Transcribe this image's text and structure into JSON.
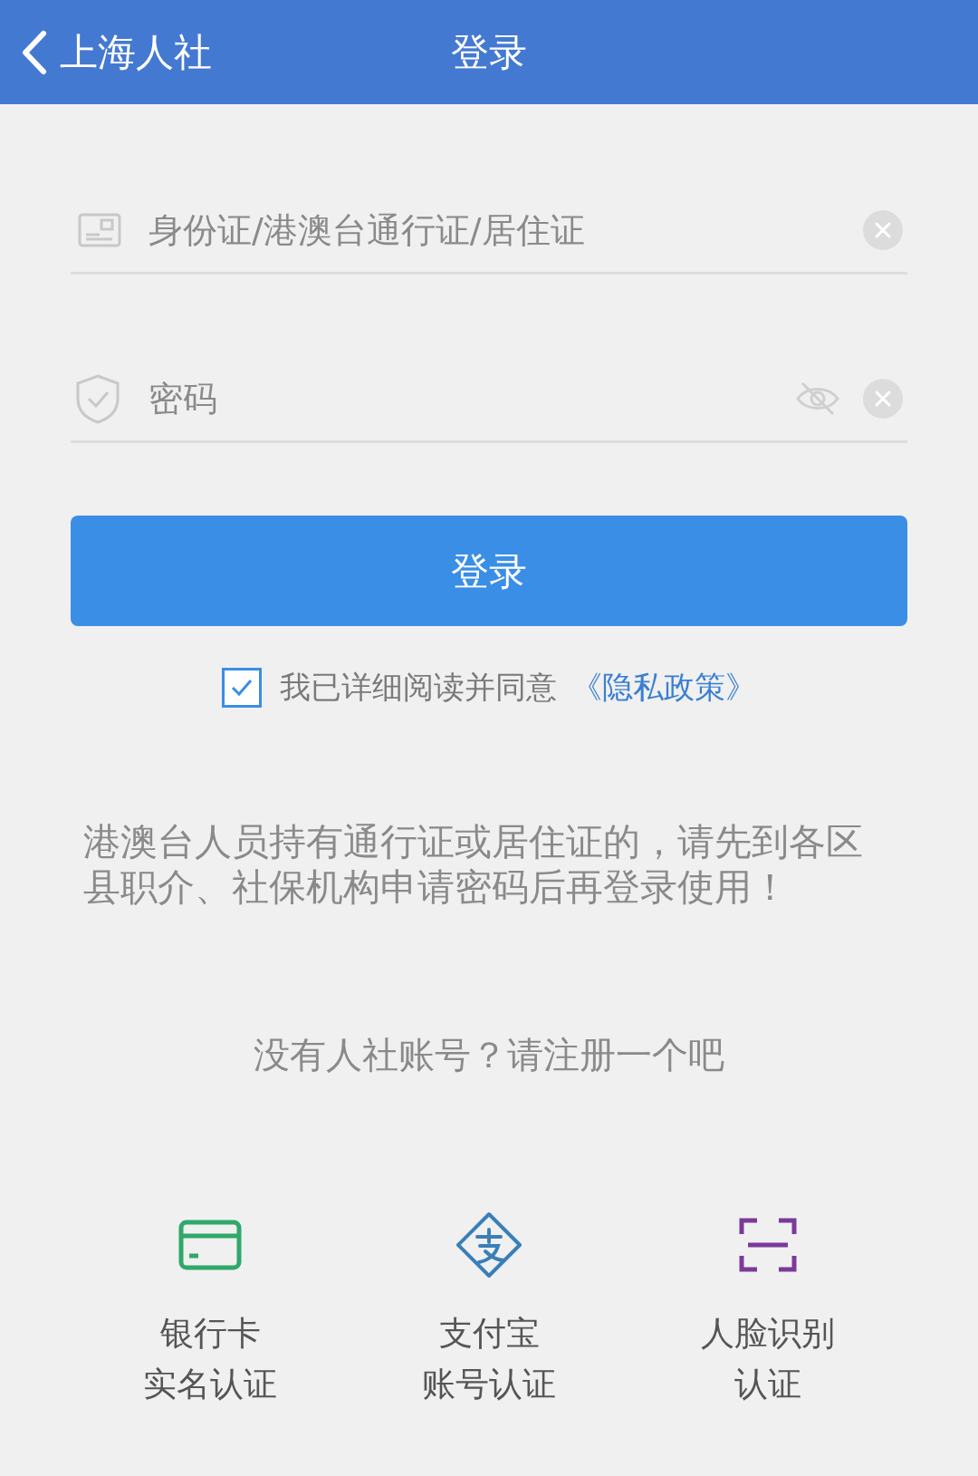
{
  "header": {
    "back_label": "上海人社",
    "title": "登录"
  },
  "fields": [
    {
      "kind": "id",
      "placeholder": "身份证/港澳台通行证/居住证"
    },
    {
      "kind": "password",
      "placeholder": "密码"
    }
  ],
  "login_button": "登录",
  "agreement": {
    "checked": true,
    "text": "我已详细阅读并同意",
    "link": "《隐私政策》"
  },
  "notice": "港澳台人员持有通行证或居住证的，请先到各区县职介、社保机构申请密码后再登录使用！",
  "register": "没有人社账号？请注册一个吧",
  "auth_options": [
    {
      "kind": "bank",
      "line1": "银行卡",
      "line2": "实名认证"
    },
    {
      "kind": "alipay",
      "line1": "支付宝",
      "line2": "账号认证"
    },
    {
      "kind": "face",
      "line1": "人脸识别",
      "line2": "认证"
    }
  ]
}
